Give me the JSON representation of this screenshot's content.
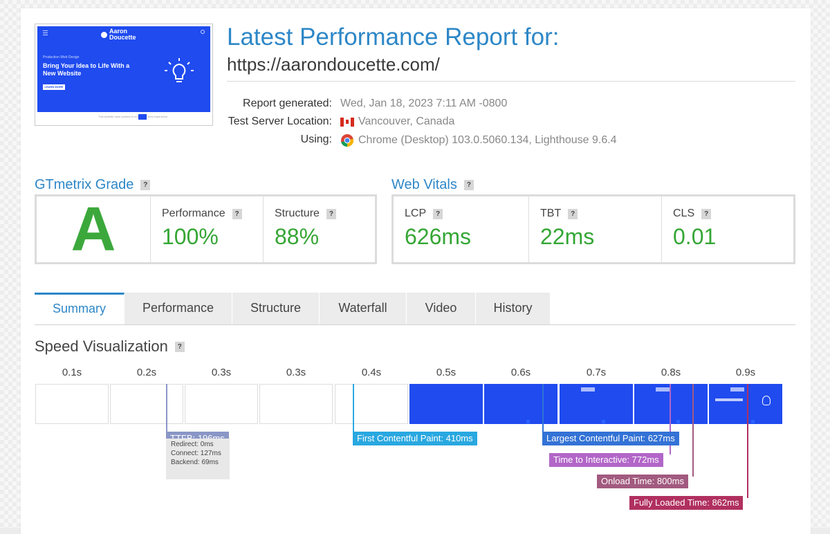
{
  "thumbnail": {
    "logo_line1": "Aaron",
    "logo_line2": "Doucette",
    "small_text": "Production Web Design",
    "headline": "Bring Your Idea to Life With a New Website",
    "button": "LEARN MORE",
    "bar_text": "This website uses cookies to ensure the best experience"
  },
  "header": {
    "title": "Latest Performance Report for:",
    "url": "https://aarondoucette.com/"
  },
  "meta": {
    "report_label": "Report generated:",
    "report_value": "Wed, Jan 18, 2023 7:11 AM -0800",
    "server_label": "Test Server Location:",
    "server_value": "Vancouver, Canada",
    "using_label": "Using:",
    "using_value": "Chrome (Desktop) 103.0.5060.134, Lighthouse 9.6.4"
  },
  "gtmetrix": {
    "title": "GTmetrix Grade",
    "help": "?",
    "grade": "A",
    "performance_label": "Performance",
    "performance_value": "100%",
    "structure_label": "Structure",
    "structure_value": "88%"
  },
  "web_vitals": {
    "title": "Web Vitals",
    "help": "?",
    "lcp_label": "LCP",
    "lcp_value": "626ms",
    "tbt_label": "TBT",
    "tbt_value": "22ms",
    "cls_label": "CLS",
    "cls_value": "0.01"
  },
  "tabs": [
    "Summary",
    "Performance",
    "Structure",
    "Waterfall",
    "Video",
    "History"
  ],
  "speed": {
    "title": "Speed Visualization",
    "help": "?",
    "times": [
      "0.1s",
      "0.2s",
      "0.3s",
      "0.3s",
      "0.4s",
      "0.5s",
      "0.6s",
      "0.7s",
      "0.8s",
      "0.9s"
    ],
    "ttfb_label": "TTFB: 196ms",
    "ttfb_redirect": "Redirect: 0ms",
    "ttfb_connect": "Connect: 127ms",
    "ttfb_backend": "Backend: 69ms",
    "fcp_label": "First Contentful Paint: 410ms",
    "lcp_label": "Largest Contentful Paint: 627ms",
    "tti_label": "Time to Interactive: 772ms",
    "onload_label": "Onload Time: 800ms",
    "fully_label": "Fully Loaded Time: 862ms"
  },
  "colors": {
    "accent": "#2d87c7",
    "good": "#35a635",
    "ttfb": "#8a96c6",
    "fcp": "#29a8e0",
    "lcp": "#3372d6",
    "tti": "#b266c8",
    "onload": "#a25a7f",
    "fully": "#b0305f"
  }
}
